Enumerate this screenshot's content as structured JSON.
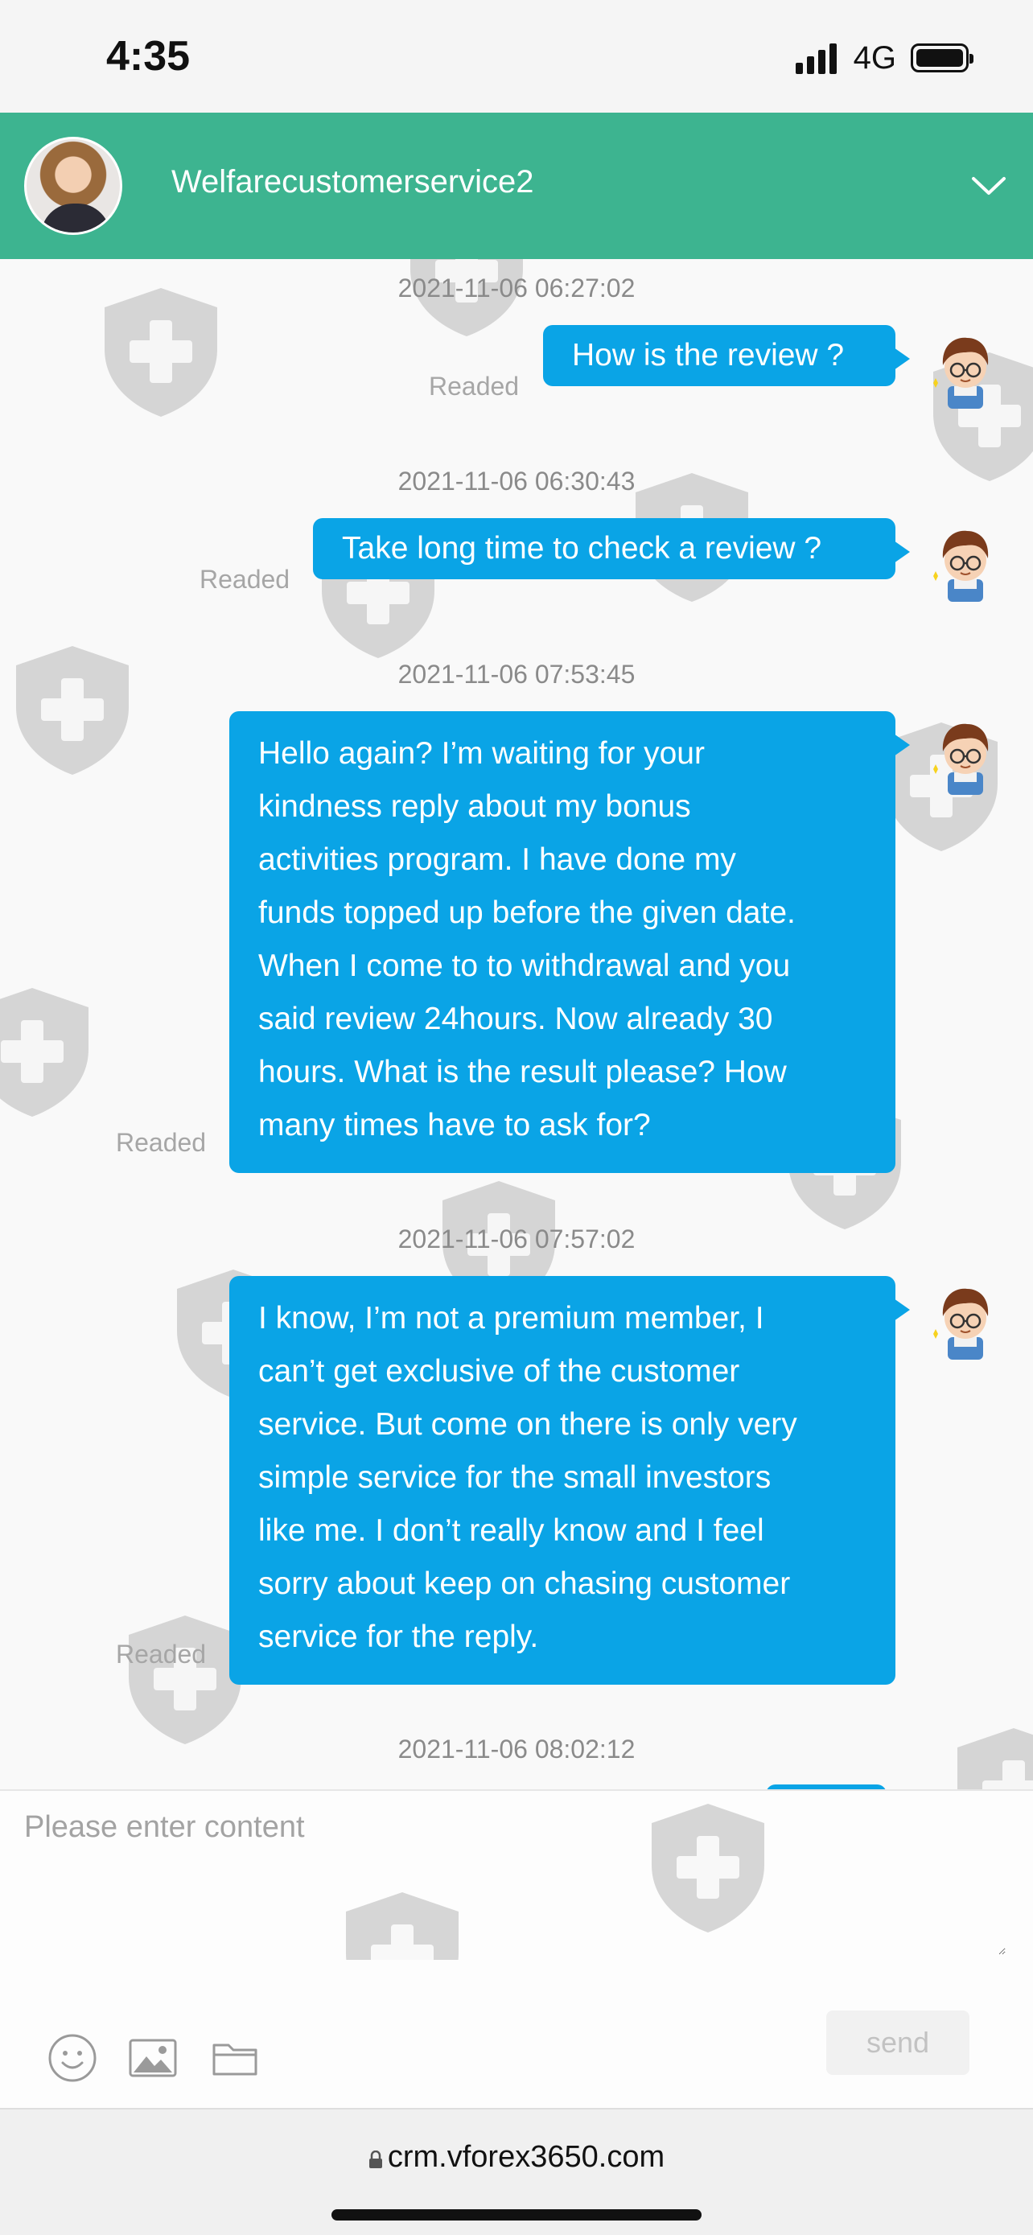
{
  "status_bar": {
    "time": "4:35",
    "network": "4G",
    "icons": [
      "signal-icon",
      "battery-icon"
    ]
  },
  "header": {
    "agent_name": "Welfarecustomerservice2",
    "avatar": "agent-avatar",
    "menu_icon": "chevron-down-icon",
    "color": "#3db490"
  },
  "messages": [
    {
      "timestamp": "2021-11-06 06:27:02",
      "status": "Readed",
      "lines": [
        "How is the review ?"
      ]
    },
    {
      "timestamp": "2021-11-06 06:30:43",
      "status": "Readed",
      "lines": [
        "Take long time to check a review ?"
      ]
    },
    {
      "timestamp": "2021-11-06 07:53:45",
      "status": "Readed",
      "lines": [
        "Hello again? I’m waiting for your",
        "kindness reply about my bonus",
        "activities program. I have done my",
        "funds topped up before the given date.",
        "When I come to to withdrawal and you",
        "said review 24hours. Now already 30",
        "hours. What is the result please? How",
        "many times have to ask for?"
      ]
    },
    {
      "timestamp": "2021-11-06 07:57:02",
      "status": "Readed",
      "lines": [
        "I know, I’m not a premium member, I",
        "can’t get exclusive of the customer",
        "service. But come on there is only very",
        "simple service for the small investors",
        "like me. I don’t really know and I feel",
        "sorry about keep on chasing customer",
        "service for the reply."
      ]
    },
    {
      "timestamp": "2021-11-06 08:02:12"
    }
  ],
  "composer": {
    "placeholder": "Please enter content",
    "value": "",
    "send_label": "send",
    "tools": [
      "emoji-icon",
      "image-icon",
      "folder-icon"
    ]
  },
  "browser": {
    "url": "crm.vforex3650.com"
  },
  "colors": {
    "bubble": "#0aa4e6",
    "header": "#3db490",
    "muted_text": "#a6a6a6"
  }
}
